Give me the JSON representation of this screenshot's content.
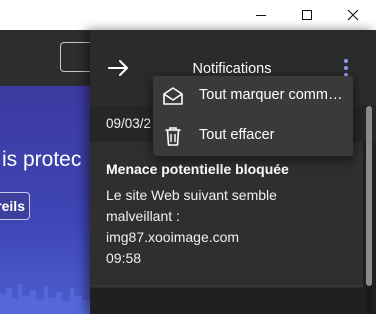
{
  "window": {
    "controls": [
      "minimize-icon",
      "maximize-icon",
      "close-icon"
    ]
  },
  "background": {
    "partial_text": "is protec",
    "partial_button": "reils"
  },
  "panel": {
    "title": "Notifications",
    "back_icon": "arrow-right-icon",
    "menu_icon": "kebab-menu-icon",
    "accent_color": "#8f9cf0",
    "date": "09/03/2",
    "notification": {
      "title": "Menace potentielle bloquée",
      "body_lines": [
        "Le site Web suivant semble",
        "malveillant :",
        "img87.xooimage.com"
      ],
      "time": "09:58"
    }
  },
  "menu": {
    "items": [
      {
        "label": "Tout marquer comme lu",
        "icon": "envelope-open-icon"
      },
      {
        "label": "Tout effacer",
        "icon": "trash-icon"
      }
    ]
  }
}
